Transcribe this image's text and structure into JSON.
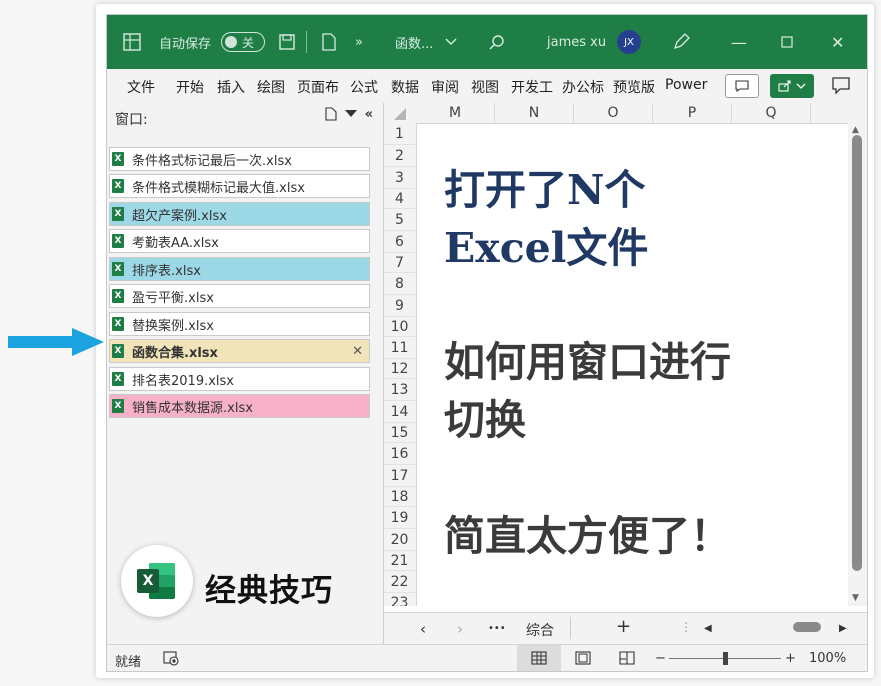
{
  "titlebar": {
    "autosave_label": "自动保存",
    "autosave_state": "关",
    "file_name": "函数...",
    "user_name": "james xu",
    "user_initials": "JX",
    "accent_color": "#1e7e46"
  },
  "ribbon": {
    "tabs": [
      "文件",
      "开始",
      "插入",
      "绘图",
      "页面布",
      "公式",
      "数据",
      "审阅",
      "视图",
      "开发工",
      "办公标",
      "预览版",
      "Power"
    ]
  },
  "pane": {
    "title": "窗口:",
    "items": [
      {
        "label": "条件格式标记最后一次.xlsx",
        "color": "#ffffff"
      },
      {
        "label": "条件格式模糊标记最大值.xlsx",
        "color": "#ffffff"
      },
      {
        "label": "超欠产案例.xlsx",
        "color": "#9dd8e6"
      },
      {
        "label": "考勤表AA.xlsx",
        "color": "#ffffff"
      },
      {
        "label": "排序表.xlsx",
        "color": "#9dd8e6"
      },
      {
        "label": "盈亏平衡.xlsx",
        "color": "#ffffff"
      },
      {
        "label": "替换案例.xlsx",
        "color": "#ffffff"
      },
      {
        "label": "函数合集.xlsx",
        "color": "#f1e4b8"
      },
      {
        "label": "排名表2019.xlsx",
        "color": "#ffffff"
      },
      {
        "label": "销售成本数据源.xlsx",
        "color": "#f7b1c8"
      }
    ],
    "active_close": "✕",
    "brand_text": "经典技巧"
  },
  "grid": {
    "columns": [
      "M",
      "N",
      "O",
      "P",
      "Q"
    ],
    "rows": [
      "1",
      "2",
      "3",
      "4",
      "5",
      "6",
      "7",
      "8",
      "9",
      "10",
      "11",
      "12",
      "13",
      "14",
      "15",
      "16",
      "17",
      "18",
      "19",
      "20",
      "21",
      "22",
      "23"
    ],
    "headline_lines": [
      "打开了N个",
      "Excel文件"
    ],
    "question_lines": [
      "如何用窗口进行",
      "切换"
    ],
    "closing_line": "简直太方便了！",
    "headline_color": "#1f3864",
    "body_color": "#3b3b3b"
  },
  "sheet_tabs": {
    "prev": "‹",
    "next": "›",
    "more": "•••",
    "active_sheet": "综合",
    "add": "+"
  },
  "statusbar": {
    "status": "就绪",
    "zoom": "100%",
    "zoom_minus": "−",
    "zoom_plus": "+"
  },
  "arrow_color": "#1aa3de"
}
